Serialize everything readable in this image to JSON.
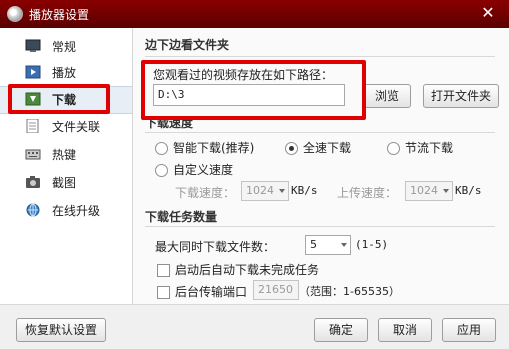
{
  "window": {
    "title": "播放器设置",
    "close_glyph": "✕"
  },
  "sidebar": {
    "items": [
      {
        "label": "常规",
        "icon": "monitor-icon"
      },
      {
        "label": "播放",
        "icon": "play-icon"
      },
      {
        "label": "下载",
        "icon": "download-icon",
        "active": true
      },
      {
        "label": "文件关联",
        "icon": "file-icon"
      },
      {
        "label": "热键",
        "icon": "keyboard-icon"
      },
      {
        "label": "截图",
        "icon": "camera-icon"
      },
      {
        "label": "在线升级",
        "icon": "globe-icon"
      }
    ]
  },
  "section1": {
    "title": "边下边看文件夹",
    "path_label": "您观看过的视频存放在如下路径：",
    "path_value": "D:\\3",
    "browse": "浏览",
    "open_folder": "打开文件夹"
  },
  "section2": {
    "title": "下载速度",
    "radios": [
      "智能下载(推荐)",
      "全速下载",
      "节流下载",
      "自定义速度"
    ],
    "selected": "全速下载",
    "download_label": "下载速度：",
    "download_value": "1024",
    "download_unit": "KB/s",
    "upload_label": "上传速度：",
    "upload_value": "1024",
    "upload_unit": "KB/s"
  },
  "section3": {
    "title": "下载任务数量",
    "max_label": "最大同时下载文件数：",
    "max_value": "5",
    "max_range": "(1-5)",
    "auto_label": "启动后自动下载未完成任务",
    "port_label": "后台传输端口",
    "port_value": "21650",
    "port_range": "（范围：1-65535）"
  },
  "footer": {
    "restore": "恢复默认设置",
    "ok": "确定",
    "cancel": "取消",
    "apply": "应用"
  },
  "colors": {
    "title_bar": "#7a0000",
    "annotation": "#e00000"
  }
}
